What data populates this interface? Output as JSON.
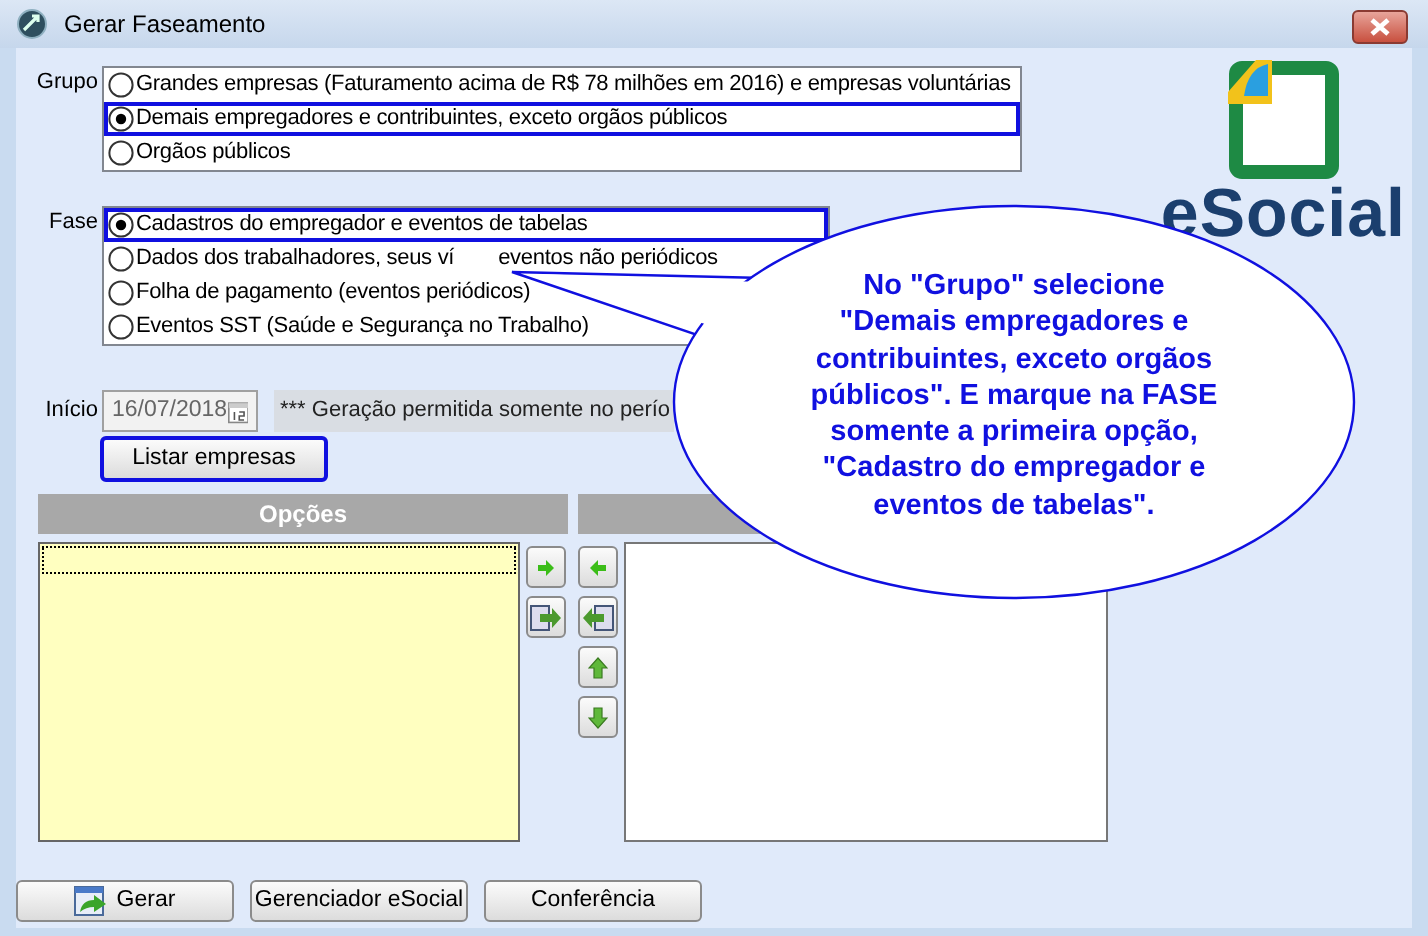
{
  "window": {
    "title": "Gerar Faseamento"
  },
  "grupo": {
    "label": "Grupo",
    "options": [
      {
        "label": "Grandes empresas (Faturamento acima de R$ 78 milhões em 2016) e empresas voluntárias",
        "selected": false
      },
      {
        "label": "Demais empregadores e contribuintes, exceto orgãos públicos",
        "selected": true
      },
      {
        "label": "Orgãos públicos",
        "selected": false
      }
    ]
  },
  "fase": {
    "label": "Fase",
    "options": [
      {
        "label": "Cadastros do empregador e eventos de tabelas",
        "selected": true
      },
      {
        "label": "Dados dos trabalhadores, seus ví",
        "label_after": "eventos não periódicos",
        "selected": false
      },
      {
        "label": "Folha de pagamento (eventos periódicos)",
        "selected": false
      },
      {
        "label": "Eventos SST (Saúde e Segurança no Trabalho)",
        "selected": false
      }
    ]
  },
  "inicio": {
    "label": "Início",
    "value": "16/07/2018",
    "note": "*** Geração permitida somente no perío"
  },
  "list_button": "Listar empresas",
  "options_panel": {
    "title": "Opções"
  },
  "bottom_buttons": [
    {
      "label": "Gerar",
      "kind": "icon"
    },
    {
      "label": "Gerenciador eSocial",
      "kind": "text"
    },
    {
      "label": "Conferência",
      "kind": "text"
    }
  ],
  "logo": {
    "text": "eSocial"
  },
  "callout": {
    "lines": [
      "No \"Grupo\" selecione",
      "\"Demais empregadores e",
      "contribuintes, exceto orgãos",
      "públicos\". E marque na FASE",
      "somente a primeira opção,",
      "\"Cadastro do empregador e",
      "eventos de tabelas\"."
    ]
  }
}
